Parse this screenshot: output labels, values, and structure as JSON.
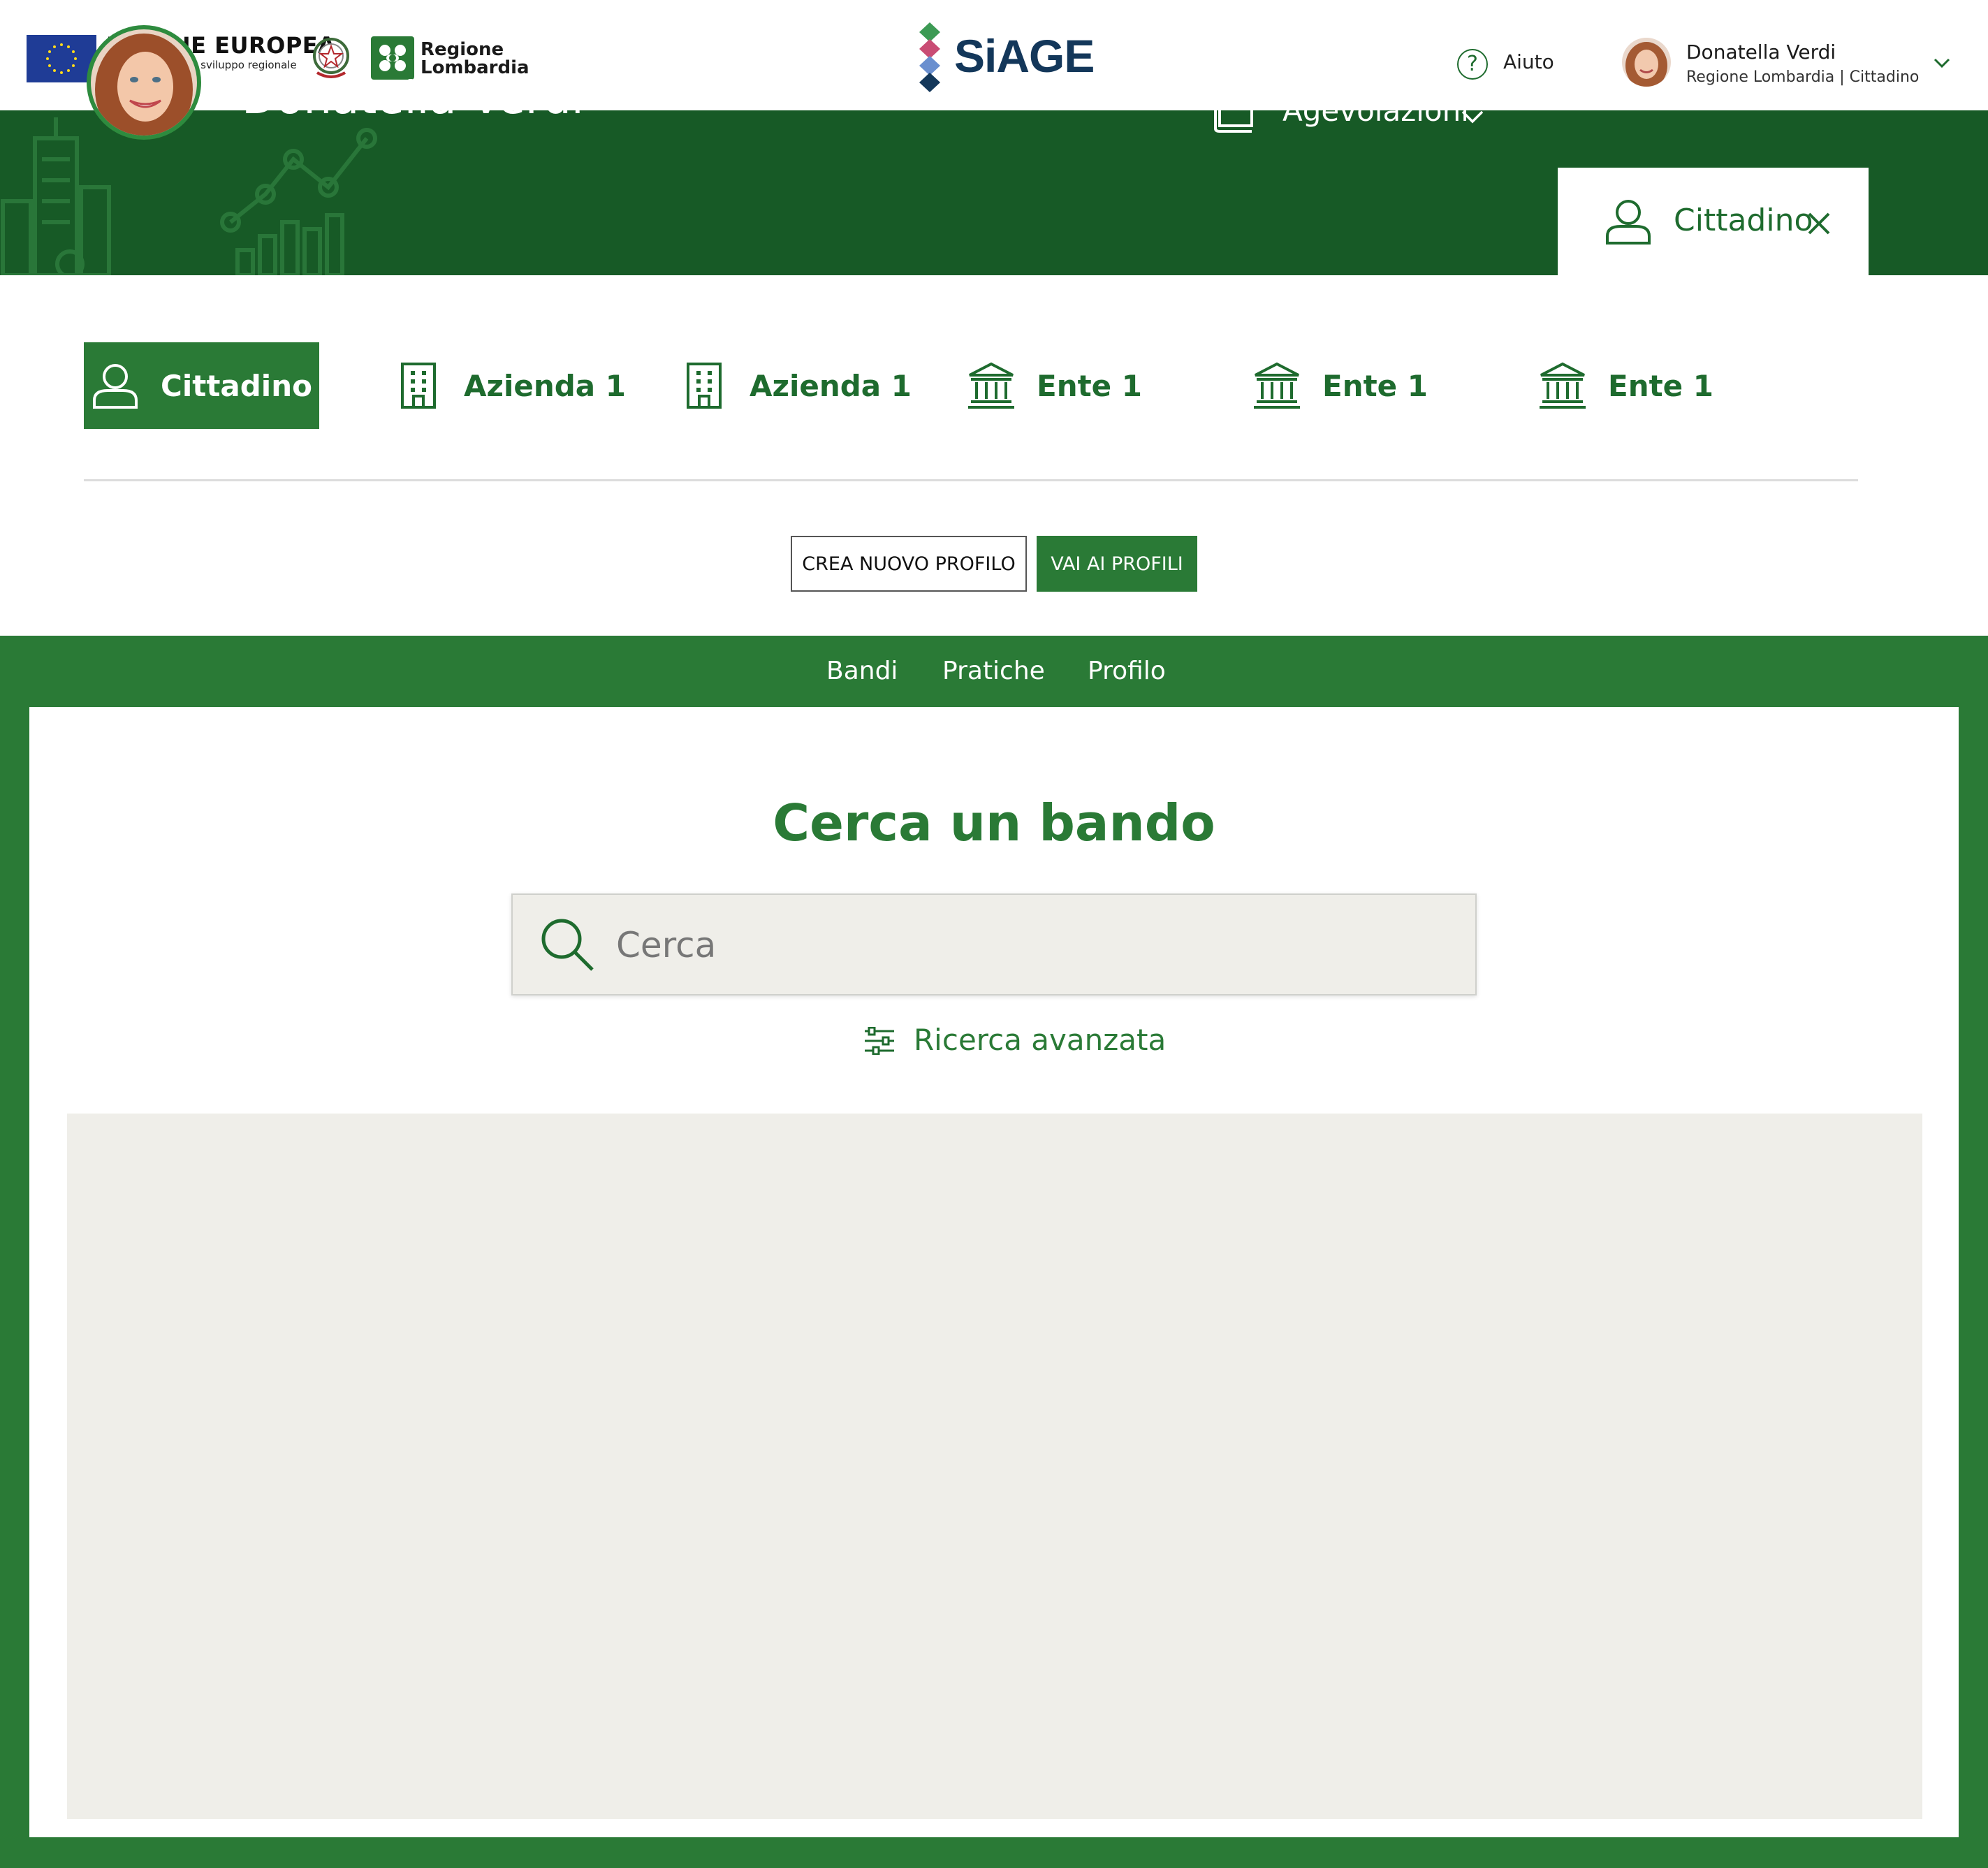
{
  "header": {
    "eu_title": "UNIONE EUROPEA",
    "eu_subtitle": "Fondo europeo di sviluppo regionale",
    "region_line1": "Regione",
    "region_line2": "Lombardia",
    "app_name": "SiAGE",
    "help_label": "Aiuto",
    "user_name": "Donatella Verdi",
    "user_role": "Regione Lombardia  |  Cittadino"
  },
  "banner": {
    "name": "Donatella Verdi",
    "menu_label": "Agevolazioni",
    "active_profile": "Cittadino"
  },
  "profiles": {
    "items": [
      {
        "label": "Cittadino",
        "icon": "user-icon",
        "active": true
      },
      {
        "label": "Azienda 1",
        "icon": "building-icon",
        "active": false
      },
      {
        "label": "Azienda 1",
        "icon": "building-icon",
        "active": false
      },
      {
        "label": "Ente 1",
        "icon": "institution-icon",
        "active": false
      },
      {
        "label": "Ente 1",
        "icon": "institution-icon",
        "active": false
      },
      {
        "label": "Ente 1",
        "icon": "institution-icon",
        "active": false
      }
    ],
    "create_label": "CREA NUOVO PROFILO",
    "goto_label": "VAI AI PROFILI"
  },
  "subnav": {
    "items": [
      "Bandi",
      "Pratiche",
      "Profilo"
    ]
  },
  "search": {
    "title": "Cerca un bando",
    "placeholder": "Cerca",
    "advanced_label": "Ricerca avanzata"
  },
  "colors": {
    "primary_green": "#2a7a36",
    "dark_green": "#175a26",
    "panel_gray": "#efeee9",
    "siage_navy": "#13375a"
  }
}
